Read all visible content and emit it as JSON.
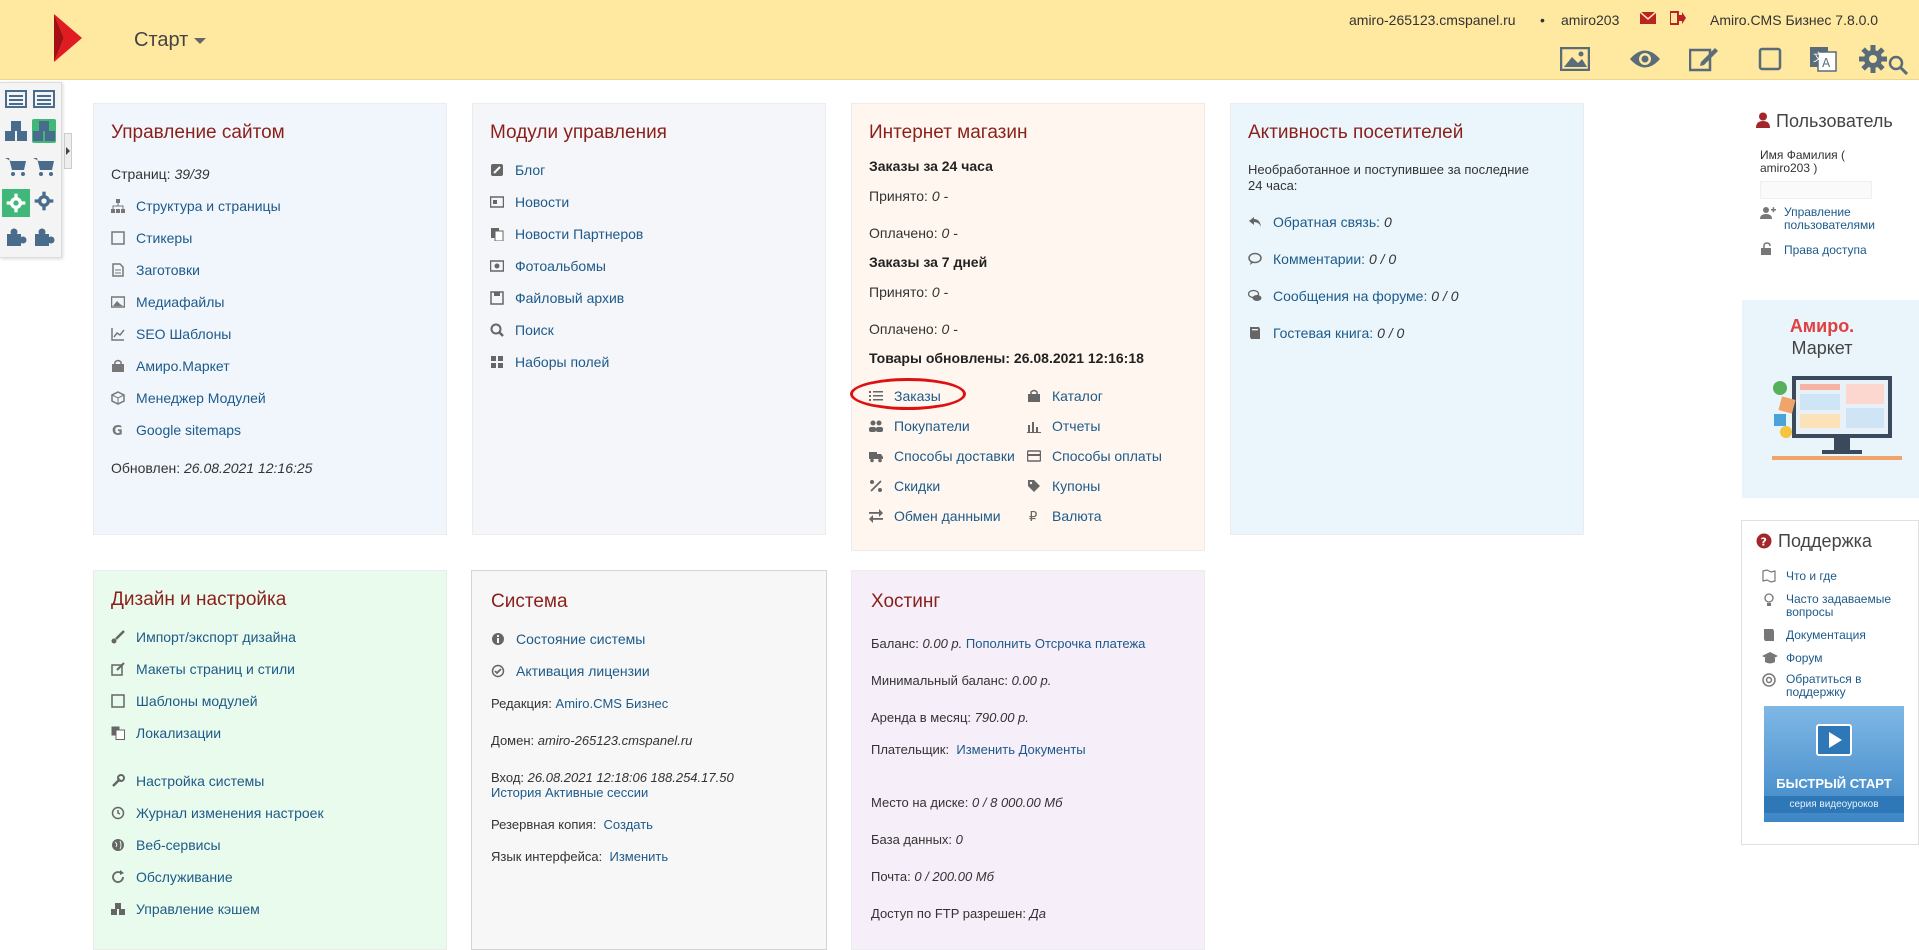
{
  "header": {
    "start_label": "Старт",
    "domain": "amiro-265123.cmspanel.ru",
    "separator": "•",
    "username": "amiro203",
    "version": "Amiro.CMS Бизнес 7.8.0.0",
    "toolbar_icons": [
      "image-icon",
      "eye-icon",
      "edit-icon",
      "square-icon",
      "translate-icon",
      "gear-icon",
      "search-icon"
    ]
  },
  "site_mgmt": {
    "title": "Управление сайтом",
    "pages_label": "Страниц:",
    "pages_value": "39/39",
    "items": [
      "Структура и страницы",
      "Стикеры",
      "Заготовки",
      "Медиафайлы",
      "SEO Шаблоны",
      "Амиро.Маркет",
      "Менеджер Модулей",
      "Google sitemaps"
    ],
    "updated_label": "Обновлен:",
    "updated_value": "26.08.2021 12:16:25"
  },
  "modules": {
    "title": "Модули управления",
    "items": [
      "Блог",
      "Новости",
      "Новости Партнеров",
      "Фотоальбомы",
      "Файловый архив",
      "Поиск",
      "Наборы полей"
    ]
  },
  "shop": {
    "title": "Интернет магазин",
    "orders24": "Заказы за 24 часа",
    "accepted_label": "Принято:",
    "accepted24": "0 -",
    "paid_label": "Оплачено:",
    "paid24": "0 -",
    "orders7": "Заказы за 7 дней",
    "accepted7": "0 -",
    "paid7": "0 -",
    "goods_updated": "Товары обновлены: 26.08.2021 12:16:18",
    "left_links": [
      "Заказы",
      "Покупатели",
      "Способы доставки",
      "Скидки",
      "Обмен данными"
    ],
    "right_links": [
      "Каталог",
      "Отчеты",
      "Способы оплаты",
      "Купоны",
      "Валюта"
    ]
  },
  "activity": {
    "title": "Активность посетителей",
    "desc1": "Необработанное и поступившее за последние",
    "desc2": "24 часа:",
    "items": [
      {
        "label": "Обратная связь:",
        "value": "0"
      },
      {
        "label": "Комментарии:",
        "value": "0 / 0"
      },
      {
        "label": "Сообщения на форуме:",
        "value": "0 / 0"
      },
      {
        "label": "Гостевая книга:",
        "value": "0 / 0"
      }
    ]
  },
  "design": {
    "title": "Дизайн и настройка",
    "items1": [
      "Импорт/экспорт дизайна",
      "Макеты страниц и стили",
      "Шаблоны модулей",
      "Локализации"
    ],
    "items2": [
      "Настройка системы",
      "Журнал изменения настроек",
      "Веб-сервисы",
      "Обслуживание",
      "Управление кэшем"
    ]
  },
  "system": {
    "title": "Система",
    "status": "Состояние системы",
    "activation": "Активация лицензии",
    "edition_label": "Редакция:",
    "edition": "Amiro.CMS Бизнес",
    "domain_label": "Домен:",
    "domain": "amiro-265123.cmspanel.ru",
    "login_label": "Вход:",
    "login": "26.08.2021 12:18:06 188.254.17.50",
    "history": "История",
    "sessions": "Активные сессии",
    "backup_label": "Резервная копия:",
    "backup": "Создать",
    "lang_label": "Язык интерфейса:",
    "lang": "Изменить"
  },
  "hosting": {
    "title": "Хостинг",
    "balance_label": "Баланс:",
    "balance": "0.00 р.",
    "topup": "Пополнить",
    "defer": "Отсрочка платежа",
    "min_label": "Минимальный баланс:",
    "min": "0.00 р.",
    "rent_label": "Аренда в месяц:",
    "rent": "790.00 р.",
    "payer_label": "Плательщик:",
    "change": "Изменить",
    "docs": "Документы",
    "disk_label": "Место на диске:",
    "disk": "0 / 8 000.00 Мб",
    "db_label": "База данных:",
    "db": "0",
    "mail_label": "Почта:",
    "mail": "0 / 200.00 Мб",
    "ftp_label": "Доступ по FTP разрешен:",
    "ftp": "Да"
  },
  "user_box": {
    "title": "Пользователь",
    "name1": "Имя Фамилия (",
    "name2": "amiro203 )",
    "manage": "Управление пользователями",
    "rights": "Права доступа"
  },
  "market_box": {
    "title1": "Амиро.",
    "title2": "Маркет"
  },
  "support": {
    "title": "Поддержка",
    "items": [
      "Что и где",
      "Часто задаваемые вопросы",
      "Документация",
      "Форум",
      "Обратиться в поддержку"
    ],
    "banner_title": "БЫСТРЫЙ СТАРТ",
    "banner_sub": "серия видеоуроков"
  },
  "colors": {
    "header_bg": "#ffe8a0",
    "title": "#8b1f1a",
    "link": "#1d5a8a",
    "accent_red": "#e01b22"
  }
}
